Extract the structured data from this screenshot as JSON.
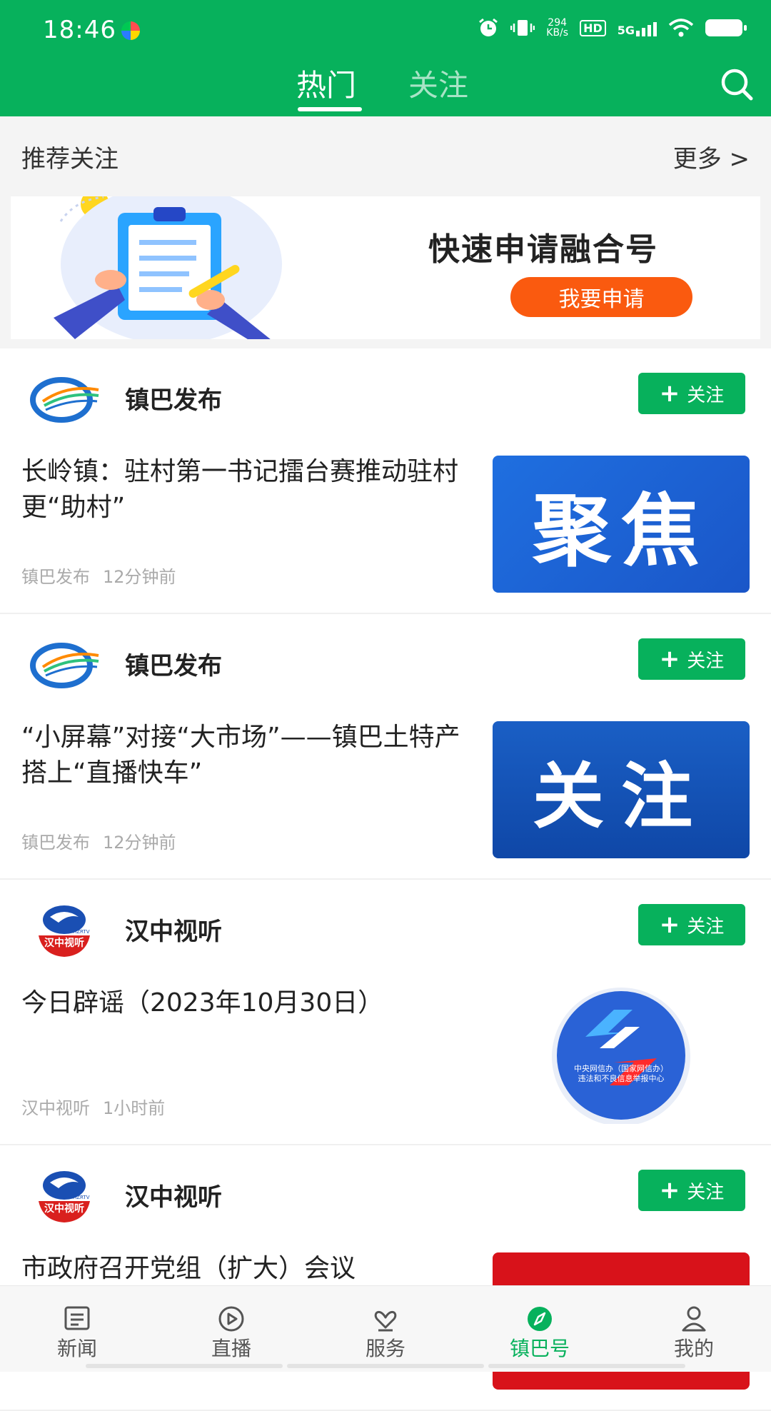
{
  "status_bar": {
    "time": "18:46",
    "net_speed_value": "294",
    "net_speed_unit": "KB/s",
    "hd_label": "HD",
    "network": "5G"
  },
  "header": {
    "tabs": [
      {
        "label": "热门",
        "active": true
      },
      {
        "label": "关注",
        "active": false
      }
    ],
    "search_icon": "search-icon"
  },
  "recommend": {
    "title": "推荐关注",
    "more": "更多 >"
  },
  "banner": {
    "title": "快速申请融合号",
    "button": "我要申请"
  },
  "feed": [
    {
      "source": "镇巴发布",
      "follow_label": "关注",
      "headline": "长岭镇：驻村第一书记擂台赛推动驻村更“助村”",
      "meta_source": "镇巴发布",
      "meta_time": "12分钟前",
      "thumb_text": "聚焦"
    },
    {
      "source": "镇巴发布",
      "follow_label": "关注",
      "headline": "“小屏幕”对接“大市场”——镇巴土特产搭上“直播快车”",
      "meta_source": "镇巴发布",
      "meta_time": "12分钟前",
      "thumb_text": "关注"
    },
    {
      "source": "汉中视听",
      "follow_label": "关注",
      "headline": "今日辟谣（2023年10月30日）",
      "meta_source": "汉中视听",
      "meta_time": "1小时前",
      "thumb_caption_1": "中央网信办（国家网信办）",
      "thumb_caption_2": "违法和不良信息举报中心"
    },
    {
      "source": "汉中视听",
      "follow_label": "关注",
      "headline": "市政府召开党组（扩大）会议"
    }
  ],
  "avatar_text": {
    "hztv_label": "汉中视听",
    "hztv_sub": "HZRTV"
  },
  "bottom_nav": [
    {
      "label": "新闻",
      "icon": "news-icon",
      "active": false
    },
    {
      "label": "直播",
      "icon": "live-play-icon",
      "active": false
    },
    {
      "label": "服务",
      "icon": "service-icon",
      "active": false
    },
    {
      "label": "镇巴号",
      "icon": "compass-icon",
      "active": true
    },
    {
      "label": "我的",
      "icon": "profile-icon",
      "active": false
    }
  ],
  "colors": {
    "brand_green": "#07b15c",
    "apply_orange": "#fa5a0f"
  }
}
